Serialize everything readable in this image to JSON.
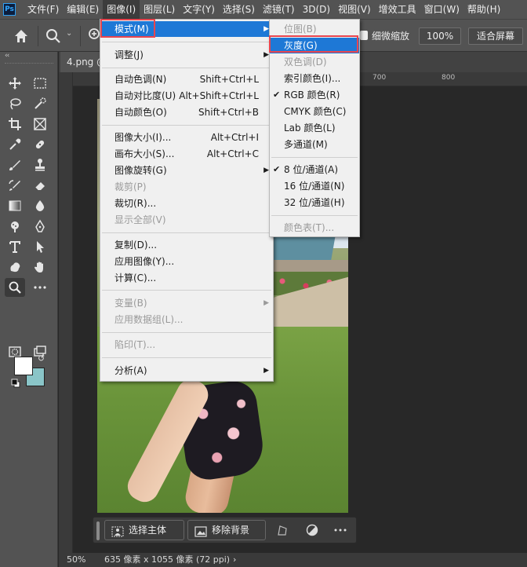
{
  "app": {
    "logo": "Ps"
  },
  "menubar": {
    "items": [
      "文件(F)",
      "编辑(E)",
      "图像(I)",
      "图层(L)",
      "文字(Y)",
      "选择(S)",
      "滤镜(T)",
      "3D(D)",
      "视图(V)",
      "增效工具",
      "窗口(W)",
      "帮助(H)"
    ],
    "active_index": 2
  },
  "options": {
    "scrubby_zoom": "细微缩放",
    "zoom_value": "100%",
    "fit_screen": "适合屏幕"
  },
  "document": {
    "tab_title": "4.png @",
    "ruler_labels": [
      "700",
      "800"
    ]
  },
  "swatches": {
    "foreground": "#ffffff",
    "background": "#8ac5c8"
  },
  "taskbar": {
    "select_subject": "选择主体",
    "remove_background": "移除背景"
  },
  "status": {
    "zoom": "50%",
    "info": "635 像素 x 1055 像素 (72 ppi)",
    "arrow": "›"
  },
  "image_menu": {
    "items": [
      {
        "label": "模式(M)",
        "shortcut": "",
        "submenu": true,
        "enabled": true,
        "highlighted": true
      },
      {
        "label": "调整(J)",
        "shortcut": "",
        "submenu": true,
        "enabled": true
      },
      {
        "label": "自动色调(N)",
        "shortcut": "Shift+Ctrl+L",
        "enabled": true
      },
      {
        "label": "自动对比度(U)",
        "shortcut": "Alt+Shift+Ctrl+L",
        "enabled": true
      },
      {
        "label": "自动颜色(O)",
        "shortcut": "Shift+Ctrl+B",
        "enabled": true
      },
      {
        "label": "图像大小(I)...",
        "shortcut": "Alt+Ctrl+I",
        "enabled": true
      },
      {
        "label": "画布大小(S)...",
        "shortcut": "Alt+Ctrl+C",
        "enabled": true
      },
      {
        "label": "图像旋转(G)",
        "shortcut": "",
        "submenu": true,
        "enabled": true
      },
      {
        "label": "裁剪(P)",
        "shortcut": "",
        "enabled": false
      },
      {
        "label": "裁切(R)...",
        "shortcut": "",
        "enabled": true
      },
      {
        "label": "显示全部(V)",
        "shortcut": "",
        "enabled": false
      },
      {
        "label": "复制(D)...",
        "shortcut": "",
        "enabled": true
      },
      {
        "label": "应用图像(Y)...",
        "shortcut": "",
        "enabled": true
      },
      {
        "label": "计算(C)...",
        "shortcut": "",
        "enabled": true
      },
      {
        "label": "变量(B)",
        "shortcut": "",
        "submenu": true,
        "enabled": false
      },
      {
        "label": "应用数据组(L)...",
        "shortcut": "",
        "enabled": false
      },
      {
        "label": "陷印(T)...",
        "shortcut": "",
        "enabled": false
      },
      {
        "label": "分析(A)",
        "shortcut": "",
        "submenu": true,
        "enabled": true
      }
    ]
  },
  "mode_submenu": {
    "items": [
      {
        "label": "位图(B)",
        "enabled": false,
        "checked": false
      },
      {
        "label": "灰度(G)",
        "enabled": true,
        "checked": false,
        "highlighted": true
      },
      {
        "label": "双色调(D)",
        "enabled": false,
        "checked": false
      },
      {
        "label": "索引颜色(I)...",
        "enabled": true,
        "checked": false
      },
      {
        "label": "RGB 颜色(R)",
        "enabled": true,
        "checked": true
      },
      {
        "label": "CMYK 颜色(C)",
        "enabled": true,
        "checked": false
      },
      {
        "label": "Lab 颜色(L)",
        "enabled": true,
        "checked": false
      },
      {
        "label": "多通道(M)",
        "enabled": true,
        "checked": false
      },
      {
        "label": "8 位/通道(A)",
        "enabled": true,
        "checked": true
      },
      {
        "label": "16 位/通道(N)",
        "enabled": true,
        "checked": false
      },
      {
        "label": "32 位/通道(H)",
        "enabled": true,
        "checked": false
      },
      {
        "label": "颜色表(T)...",
        "enabled": false,
        "checked": false
      }
    ]
  }
}
